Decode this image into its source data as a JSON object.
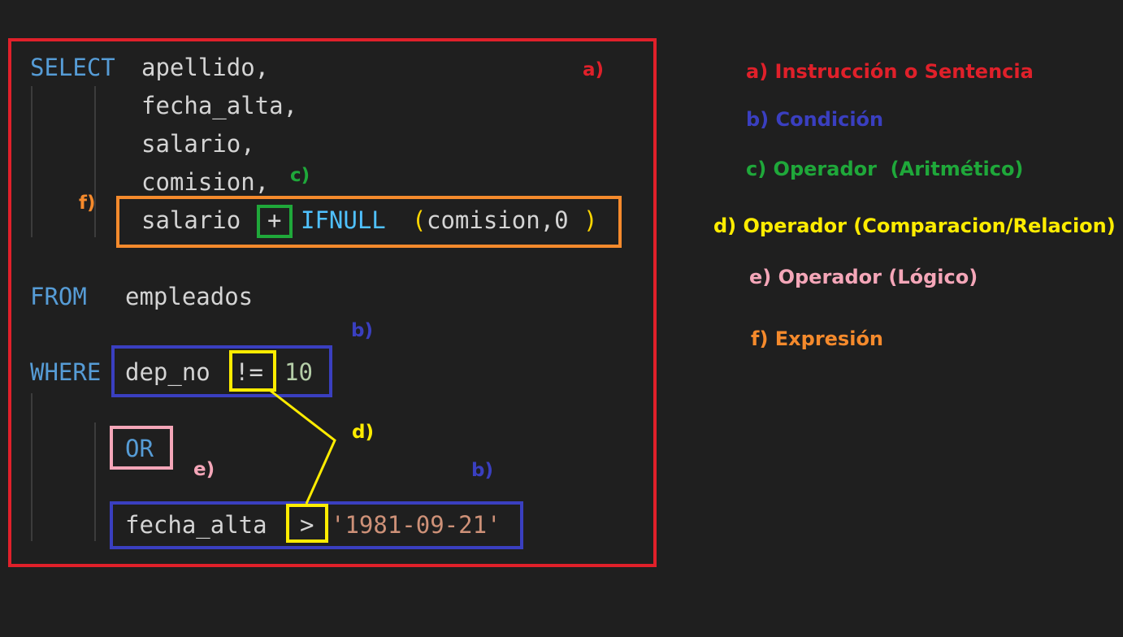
{
  "code": {
    "select_kw": "SELECT",
    "col1": "apellido,",
    "col2": "fecha_alta,",
    "col3": "salario,",
    "col4": "comision,",
    "expr_left": "salario",
    "plus": "+",
    "ifnull": "IFNULL",
    "paren_open": "(",
    "ifnull_args": "comision,0",
    "paren_close": ")",
    "from_kw": "FROM",
    "table": "empleados",
    "where_kw": "WHERE",
    "cond1_col": "dep_no",
    "cond1_op": "!=",
    "cond1_val": "10",
    "or_kw": "OR",
    "cond2_col": "fecha_alta",
    "cond2_op": ">",
    "cond2_val": "'1981-09-21'"
  },
  "annotations": {
    "a": "a)",
    "b1": "b)",
    "b2": "b)",
    "c": "c)",
    "d": "d)",
    "e": "e)",
    "f": "f)"
  },
  "legend": {
    "a": "a) Instrucción o Sentencia",
    "b": "b) Condición",
    "c": "c) Operador  (Aritmético)",
    "d": "d) Operador (Comparacion/Relacion)",
    "e": "e) Operador (Lógico)",
    "f": "f) Expresión"
  },
  "colors": {
    "background": "#1f1f1f",
    "statement_red": "#e0202a",
    "condition_blue": "#3a3fc0",
    "arith_green": "#1fa83a",
    "comparison_yellow": "#ffec00",
    "logical_pink": "#f4a6b8",
    "expression_orange": "#f58a2c"
  }
}
